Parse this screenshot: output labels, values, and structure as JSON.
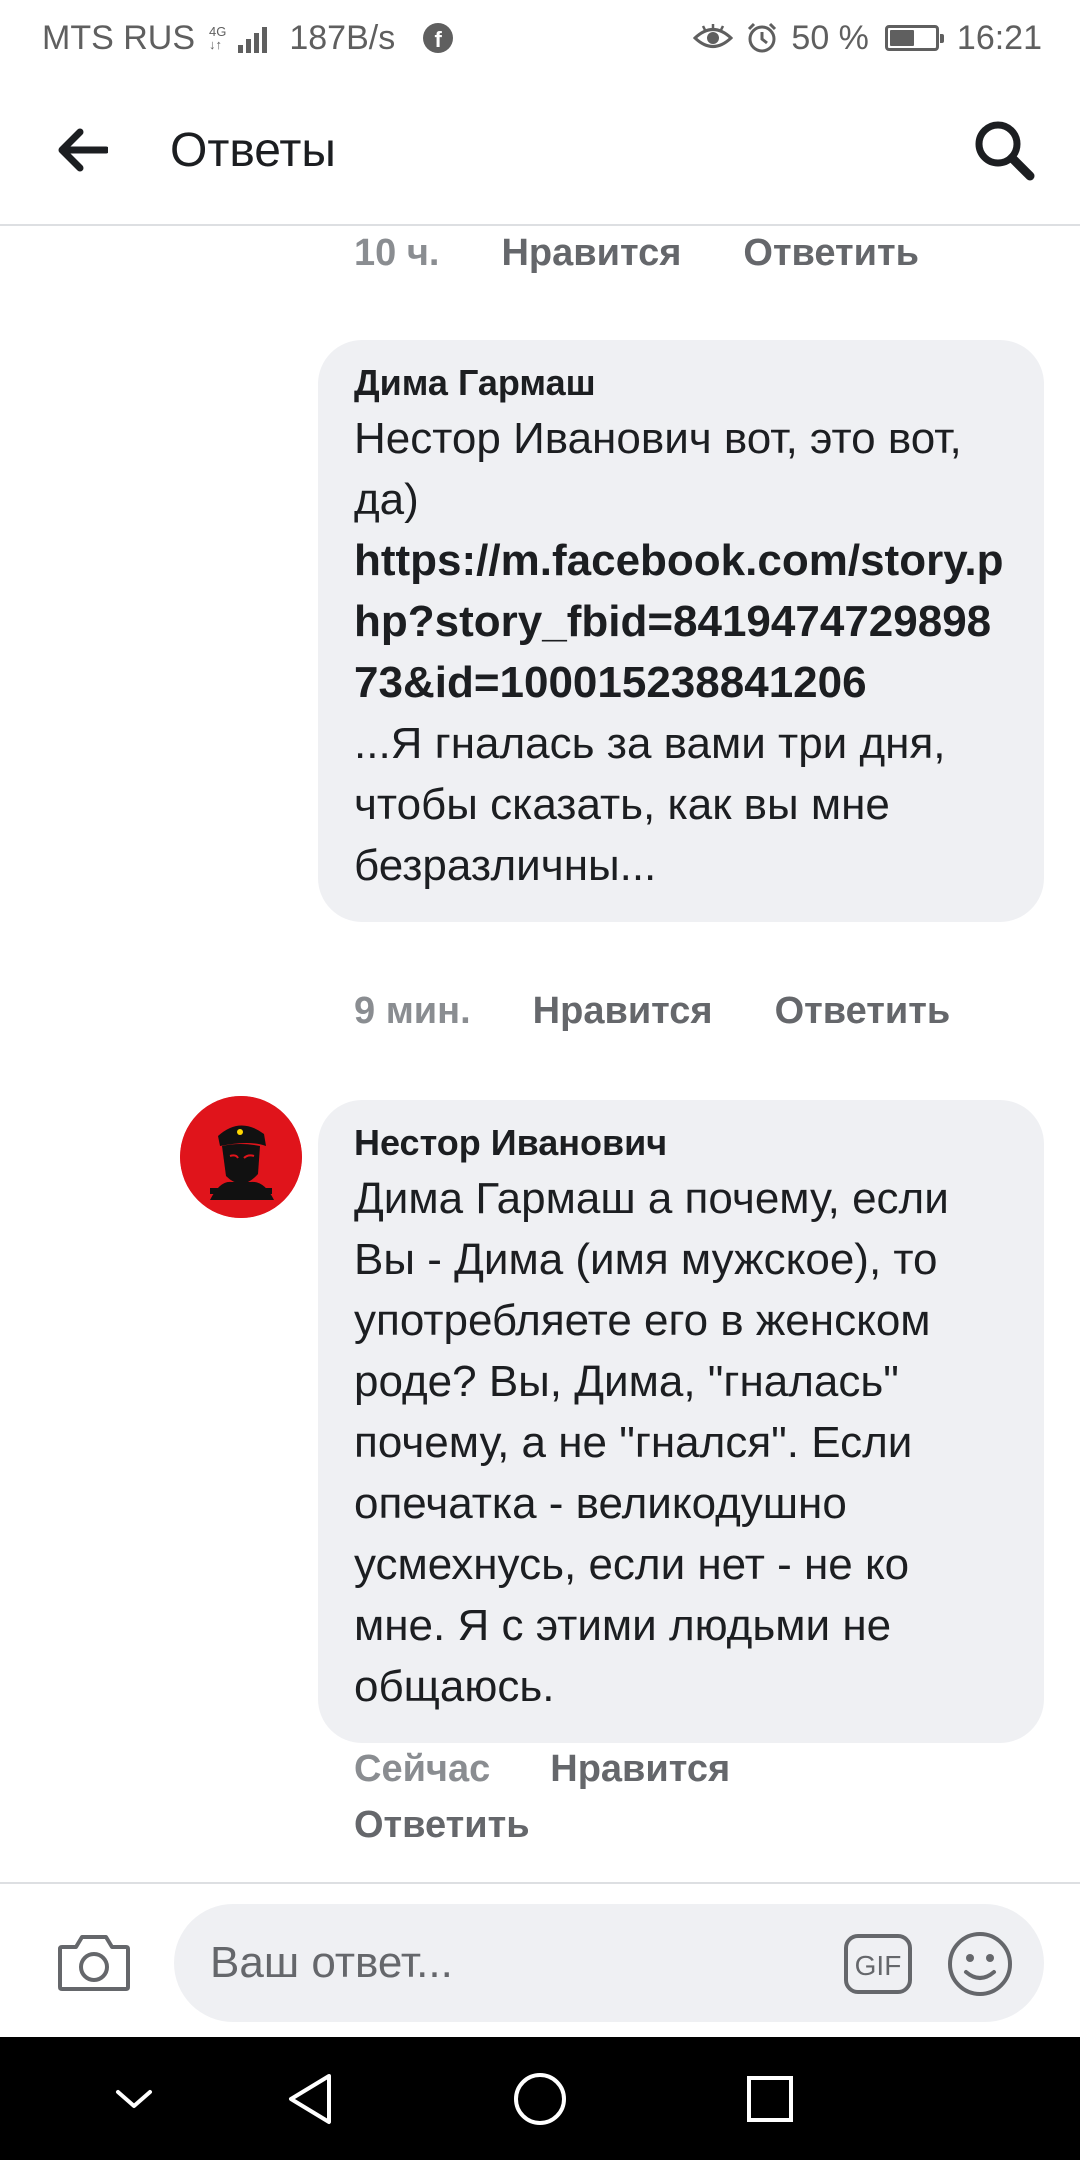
{
  "status_bar": {
    "carrier": "MTS RUS",
    "network_top": "4G",
    "network_bottom": "↓↑",
    "speed": "187B/s",
    "battery": "50 %",
    "battery_level": 0.5,
    "time": "16:21"
  },
  "header": {
    "title": "Ответы"
  },
  "comments": [
    {
      "time": "10 ч.",
      "like": "Нравится",
      "reply": "Ответить"
    },
    {
      "author": "Дима Гармаш",
      "text_before": "Нестор Иванович вот, это вот, да)",
      "link": "https://m.facebook.com/story.php?story_fbid=841947472989873&id=100015238841206",
      "text_after": "...Я гналась за вами три дня, чтобы сказать, как вы мне безразличны...",
      "time": "9 мин.",
      "like": "Нравится",
      "reply": "Ответить"
    },
    {
      "author": "Нестор Иванович",
      "text": "Дима Гармаш а почему, если Вы - Дима (имя мужское), то употребляете его в женском роде? Вы, Дима, \"гналась\" почему, а не \"гнался\". Если опечатка - великодушно усмехнусь, если нет - не ко мне. Я с этими людьми не общаюсь.",
      "time": "Сейчас",
      "like": "Нравится",
      "reply": "Ответить"
    }
  ],
  "composer": {
    "placeholder": "Ваш ответ...",
    "gif_label": "GIF"
  },
  "icons": {
    "back": "arrow-left-icon",
    "search": "search-icon",
    "camera": "camera-icon",
    "gif": "gif-icon",
    "emoji": "smiley-icon",
    "nav_down": "chevron-down-icon",
    "nav_back": "triangle-back-icon",
    "nav_home": "circle-home-icon",
    "nav_recents": "square-recents-icon"
  },
  "colors": {
    "bubble": "#eff0f3",
    "meta_text": "#65676b",
    "avatar_bg": "#e0141b"
  }
}
